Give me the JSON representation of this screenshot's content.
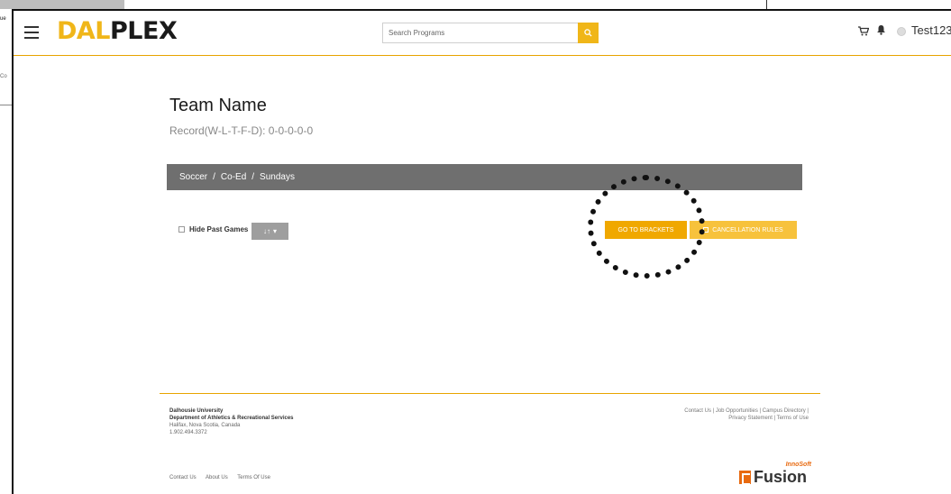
{
  "background": {
    "label_1": "ue",
    "label_2": "Co"
  },
  "header": {
    "logo_part1": "DAL",
    "logo_part2": "PLEX",
    "search_placeholder": "Search Programs",
    "user_name": "Test123"
  },
  "team": {
    "title": "Team Name",
    "record": "Record(W-L-T-F-D): 0-0-0-0-0"
  },
  "breadcrumb": {
    "sport": "Soccer",
    "division": "Co-Ed",
    "league": "Sundays"
  },
  "controls": {
    "hide_past_label": "Hide Past Games",
    "sort_label": "↓↑",
    "go_to_brackets": "GO TO BRACKETS",
    "cancellation_rules": "CANCELLATION RULES"
  },
  "footer": {
    "university": "Dalhousie University",
    "department": "Department of Athletics & Recreational Services",
    "location": "Halifax, Nova Scotia, Canada",
    "phone": "1.902.494.3372",
    "right_line1": "Contact Us | Job Opportunities | Campus Directory |",
    "right_line2": "Privacy Statement | Terms of Use",
    "links": [
      "Contact Us",
      "About Us",
      "Terms Of Use"
    ],
    "brand_top": "InnoSoft",
    "brand_word": "Fusion"
  },
  "colors": {
    "accent": "#f0b619",
    "button_primary": "#f0a800",
    "button_secondary": "#f7c23c",
    "breadcrumb_bg": "#6f6f6f",
    "footer_line": "#e8a400"
  }
}
